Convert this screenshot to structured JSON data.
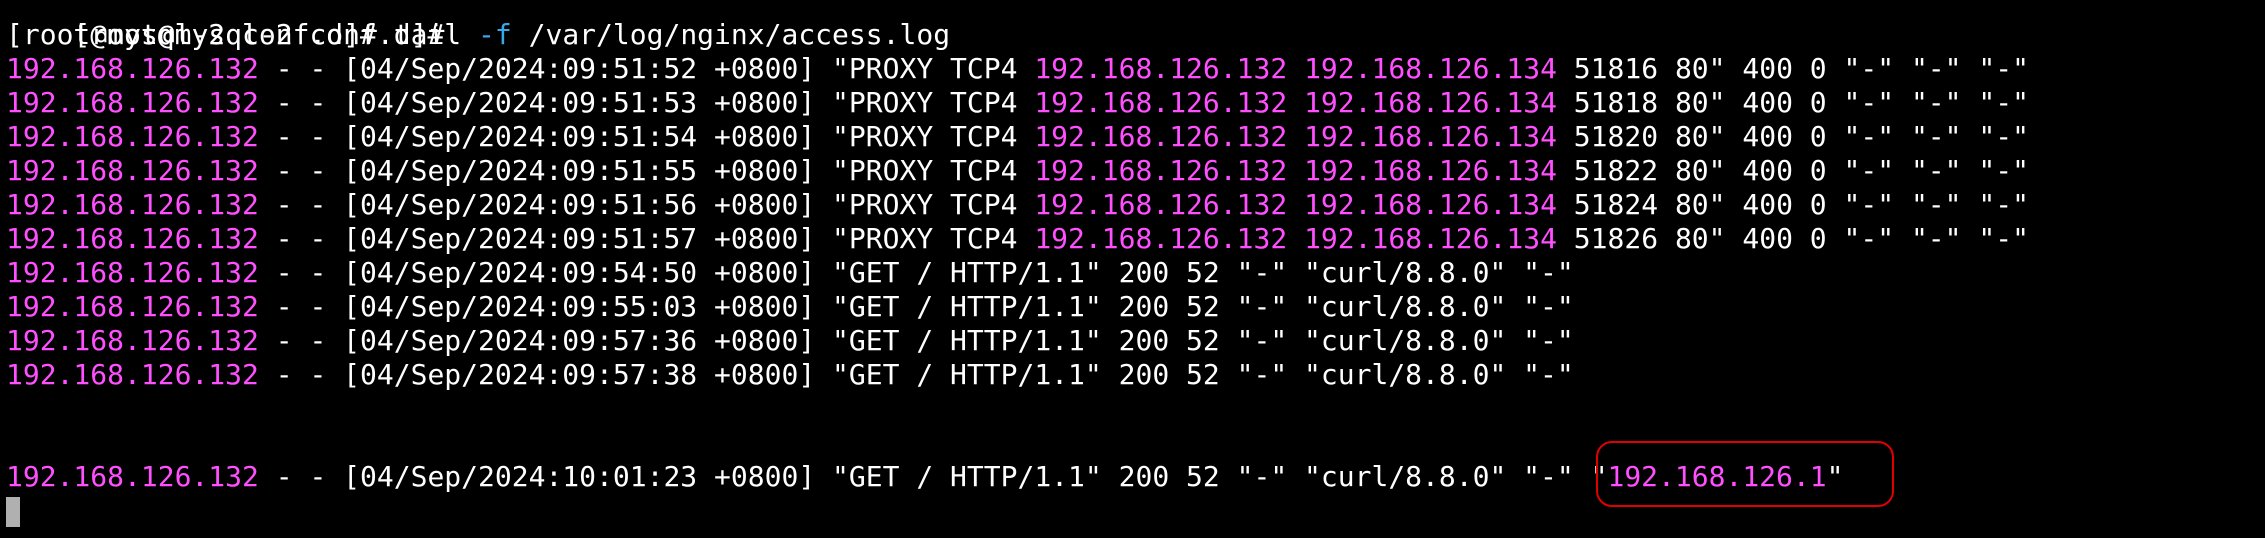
{
  "colors": {
    "ip": "#ff4fff",
    "flag": "#3aa7e6",
    "highlight": "#e00000",
    "cursor": "#b0b0b0"
  },
  "terminal": {
    "prev_prompt": "[root@mysql-2 conf.d]#",
    "prompt": "[root@mysql-2 conf.d]#",
    "command": "tail",
    "flag": "-f",
    "path": "/var/log/nginx/access.log",
    "proxy_lines": [
      {
        "client": "192.168.126.132",
        "mid": " - - [04/Sep/2024:09:51:52 +0800] \"PROXY TCP4 ",
        "src": "192.168.126.132",
        "dst": "192.168.126.134",
        "tail": " 51816 80\" 400 0 \"-\" \"-\" \"-\""
      },
      {
        "client": "192.168.126.132",
        "mid": " - - [04/Sep/2024:09:51:53 +0800] \"PROXY TCP4 ",
        "src": "192.168.126.132",
        "dst": "192.168.126.134",
        "tail": " 51818 80\" 400 0 \"-\" \"-\" \"-\""
      },
      {
        "client": "192.168.126.132",
        "mid": " - - [04/Sep/2024:09:51:54 +0800] \"PROXY TCP4 ",
        "src": "192.168.126.132",
        "dst": "192.168.126.134",
        "tail": " 51820 80\" 400 0 \"-\" \"-\" \"-\""
      },
      {
        "client": "192.168.126.132",
        "mid": " - - [04/Sep/2024:09:51:55 +0800] \"PROXY TCP4 ",
        "src": "192.168.126.132",
        "dst": "192.168.126.134",
        "tail": " 51822 80\" 400 0 \"-\" \"-\" \"-\""
      },
      {
        "client": "192.168.126.132",
        "mid": " - - [04/Sep/2024:09:51:56 +0800] \"PROXY TCP4 ",
        "src": "192.168.126.132",
        "dst": "192.168.126.134",
        "tail": " 51824 80\" 400 0 \"-\" \"-\" \"-\""
      },
      {
        "client": "192.168.126.132",
        "mid": " - - [04/Sep/2024:09:51:57 +0800] \"PROXY TCP4 ",
        "src": "192.168.126.132",
        "dst": "192.168.126.134",
        "tail": " 51826 80\" 400 0 \"-\" \"-\" \"-\""
      }
    ],
    "get_lines": [
      {
        "client": "192.168.126.132",
        "rest": " - - [04/Sep/2024:09:54:50 +0800] \"GET / HTTP/1.1\" 200 52 \"-\" \"curl/8.8.0\" \"-\""
      },
      {
        "client": "192.168.126.132",
        "rest": " - - [04/Sep/2024:09:55:03 +0800] \"GET / HTTP/1.1\" 200 52 \"-\" \"curl/8.8.0\" \"-\""
      },
      {
        "client": "192.168.126.132",
        "rest": " - - [04/Sep/2024:09:57:36 +0800] \"GET / HTTP/1.1\" 200 52 \"-\" \"curl/8.8.0\" \"-\""
      },
      {
        "client": "192.168.126.132",
        "rest": " - - [04/Sep/2024:09:57:38 +0800] \"GET / HTTP/1.1\" 200 52 \"-\" \"curl/8.8.0\" \"-\""
      }
    ],
    "final_line": {
      "client": "192.168.126.132",
      "rest": " - - [04/Sep/2024:10:01:23 +0800] \"GET / HTTP/1.1\" 200 52 \"-\" \"curl/8.8.0\" \"-\" \"",
      "forwarded": "192.168.126.1",
      "close": "\""
    }
  }
}
